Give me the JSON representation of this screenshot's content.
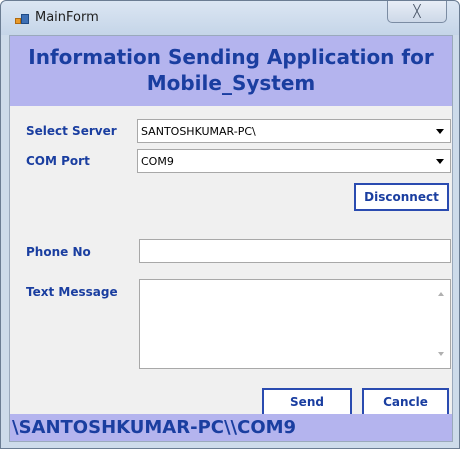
{
  "window": {
    "title": "MainForm",
    "close_glyph": "╳"
  },
  "header": {
    "line1": "Information Sending Application for",
    "line2": "Mobile_System"
  },
  "form": {
    "select_server_label": "Select Server",
    "select_server_value": "SANTOSHKUMAR-PC\\",
    "com_port_label": "COM Port",
    "com_port_value": "COM9",
    "disconnect_label": "Disconnect",
    "phone_label": "Phone No",
    "phone_value": "",
    "message_label": "Text Message",
    "message_value": "",
    "send_label": "Send",
    "cancel_label": "Cancle"
  },
  "status": {
    "text": "\\SANTOSHKUMAR-PC\\\\COM9"
  },
  "colors": {
    "accent": "#1a3ea0",
    "band": "#b4b4ee"
  }
}
